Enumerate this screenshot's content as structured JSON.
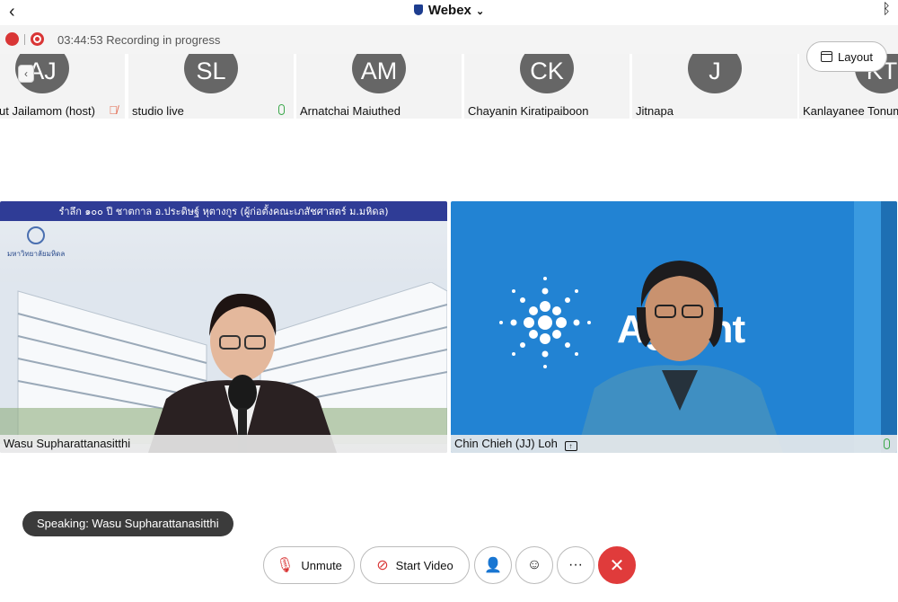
{
  "app": {
    "title": "Webex"
  },
  "recording": {
    "timer": "03:44:53",
    "status": "Recording in progress",
    "mute_badge": "✕"
  },
  "layout_button": {
    "label": "Layout"
  },
  "participants": [
    {
      "initials": "AJ",
      "name": "ut Jailamom (host)",
      "mic": "muted"
    },
    {
      "initials": "SL",
      "name": "studio live",
      "mic": "on"
    },
    {
      "initials": "AM",
      "name": "Arnatchai Maiuthed",
      "mic": "none"
    },
    {
      "initials": "CK",
      "name": "Chayanin Kiratipaiboon",
      "mic": "none"
    },
    {
      "initials": "J",
      "name": "Jitnapa",
      "mic": "none"
    },
    {
      "initials": "KT",
      "name": "Kanlayanee Tonum",
      "mic": "none"
    }
  ],
  "videos": [
    {
      "name": "Wasu Supharattanasitthi",
      "banner": "รำลึก ๑๐๐ ปี ชาตกาล อ.ประดิษฐ์ หุตางกูร (ผู้ก่อตั้งคณะเภสัชศาสตร์ ม.มหิดล)",
      "logo_text": "มหาวิทยาลัยมหิดล"
    },
    {
      "name": "Chin Chieh (JJ) Loh",
      "share_badge": "↑",
      "brand": "Agilent"
    }
  ],
  "speaking": {
    "label": "Speaking: Wasu Supharattanasitthi"
  },
  "controls": {
    "unmute": "Unmute",
    "start_video": "Start Video",
    "more": "···",
    "end": "✕"
  },
  "icons": {
    "back": "chevron-left-icon",
    "bluetooth": "bluetooth-icon",
    "participants": "participants-icon",
    "reactions": "emoji-icon"
  },
  "colors": {
    "end_call": "#e03b3b",
    "recording": "#d93636",
    "mic_on": "#3aa84a",
    "brand_blue": "#2283d3"
  }
}
